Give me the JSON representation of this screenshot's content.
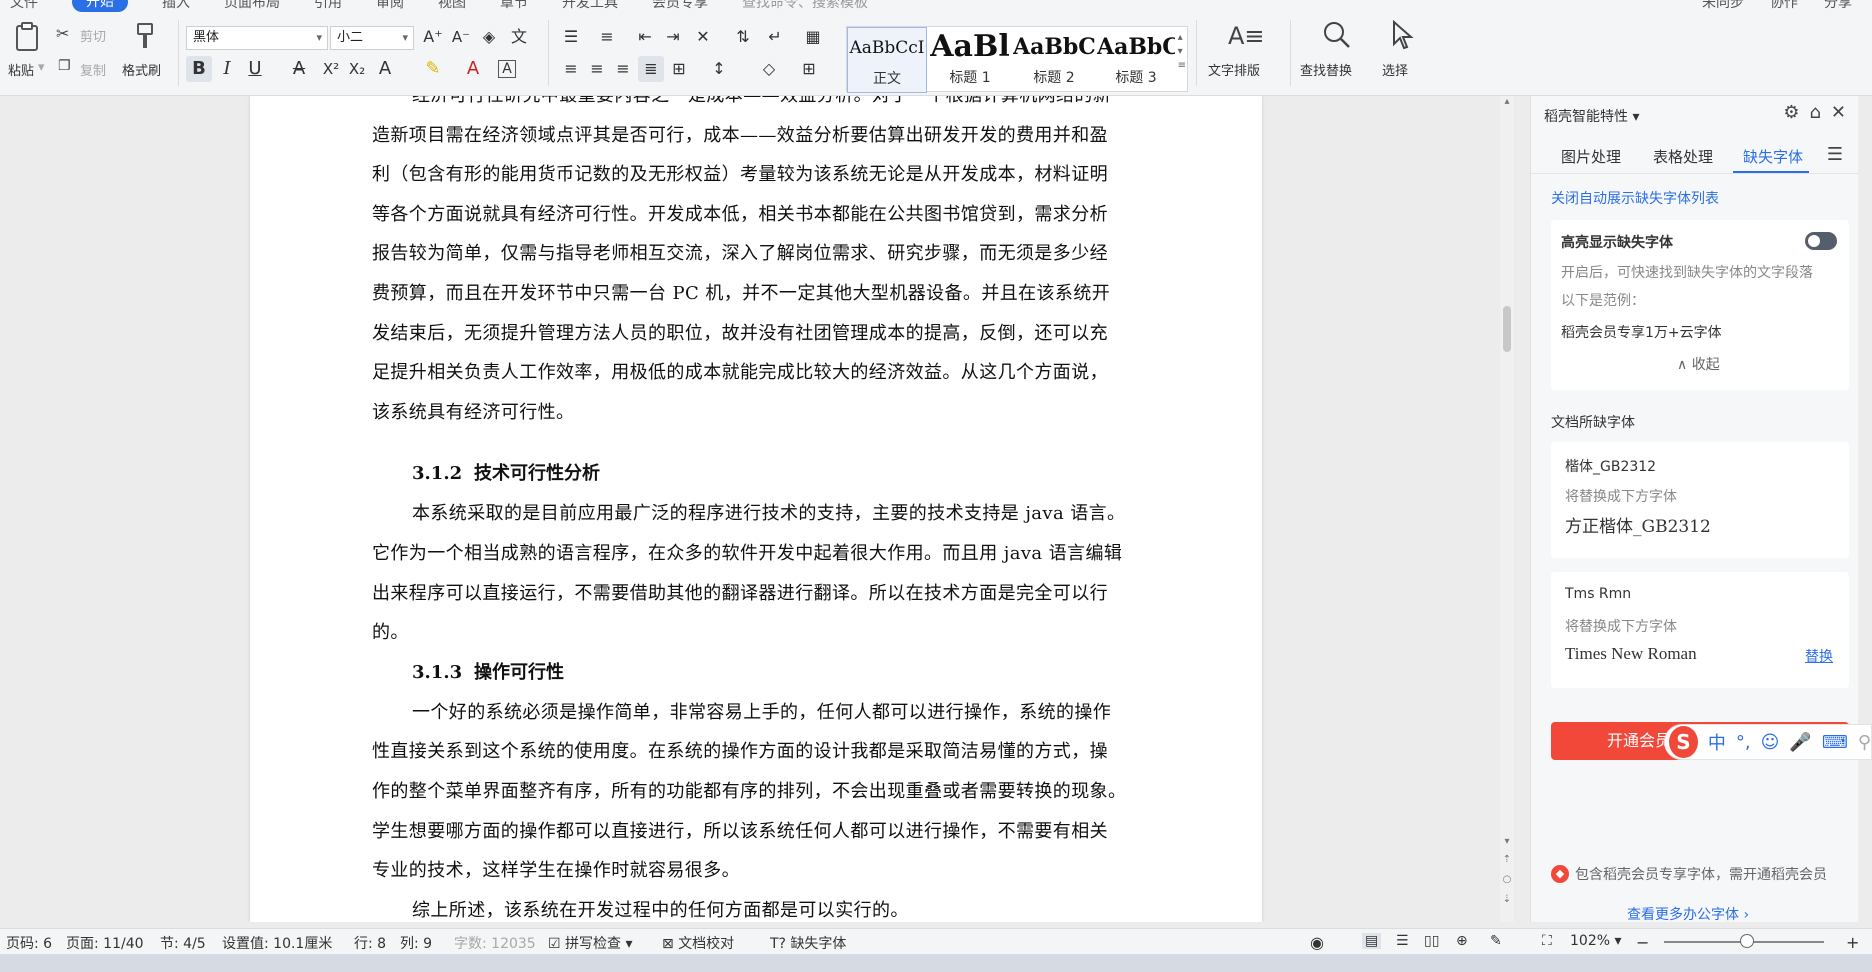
{
  "topbar": {
    "menus": [
      "文件",
      "开始",
      "插入",
      "页面布局",
      "引用",
      "审阅",
      "视图",
      "章节",
      "开发工具",
      "会员专享"
    ],
    "active_menu": "开始",
    "search": "查找命令、搜索模板",
    "right": [
      "未同步",
      "协作",
      "分享"
    ]
  },
  "ribbon": {
    "paste": "粘贴",
    "cut": "剪切",
    "copy": "复制",
    "format_painter": "格式刷",
    "font_name": "黑体",
    "font_size": "小二",
    "styles": [
      {
        "sample": "AaBbCcI",
        "label": "正文"
      },
      {
        "sample": "AaBl",
        "label": "标题 1"
      },
      {
        "sample": "AaBbC",
        "label": "标题 2"
      },
      {
        "sample": "AaBbC",
        "label": "标题 3"
      }
    ],
    "text_layout": "文字排版",
    "find_replace": "查找替换",
    "select": "选择"
  },
  "document": {
    "para1": [
      "经济可行性研究中最重要内容之一是成本——效益分析。对于一个根据计算机网络的新",
      "造新项目需在经济领域点评其是否可行，成本——效益分析要估算出研发开发的费用并和盈",
      "利（包含有形的能用货币记数的及无形权益）考量较为该系统无论是从开发成本，材料证明",
      "等各个方面说就具有经济可行性。开发成本低，相关书本都能在公共图书馆贷到，需求分析",
      "报告较为简单，仅需与指导老师相互交流，深入了解岗位需求、研究步骤，而无须是多少经",
      "费预算，而且在开发环节中只需一台 PC 机，并不一定其他大型机器设备。并且在该系统开",
      "发结束后，无须提升管理方法人员的职位，故并没有社团管理成本的提高，反倒，还可以充",
      "足提升相关负责人工作效率，用极低的成本就能完成比较大的经济效益。从这几个方面说，",
      "该系统具有经济可行性。"
    ],
    "h312_num": "3.1.2",
    "h312_title": "技术可行性分析",
    "para2": [
      "本系统采取的是目前应用最广泛的程序进行技术的支持，主要的技术支持是 java 语言。",
      "它作为一个相当成熟的语言程序，在众多的软件开发中起着很大作用。而且用 java 语言编辑",
      "出来程序可以直接运行，不需要借助其他的翻译器进行翻译。所以在技术方面是完全可以行",
      "的。"
    ],
    "h313_num": "3.1.3",
    "h313_title": "操作可行性",
    "para3": [
      "一个好的系统必须是操作简单，非常容易上手的，任何人都可以进行操作，系统的操作",
      "性直接关系到这个系统的使用度。在系统的操作方面的设计我都是采取简洁易懂的方式，操",
      "作的整个菜单界面整齐有序，所有的功能都有序的排列，不会出现重叠或者需要转换的现象。",
      "学生想要哪方面的操作都可以直接进行，所以该系统任何人都可以进行操作，不需要有相关",
      "专业的技术，这样学生在操作时就容易很多。"
    ],
    "para4": "综上所述，该系统在开发过程中的任何方面都是可以实行的。"
  },
  "panel": {
    "title": "稻壳智能特性",
    "tabs": [
      "图片处理",
      "表格处理",
      "缺失字体"
    ],
    "close_auto_link": "关闭自动展示缺失字体列表",
    "highlight_title": "高亮显示缺失字体",
    "highlight_desc": "开启后，可快速找到缺失字体的文字段落",
    "example_label": "以下是范例：",
    "example_value": "稻壳会员专享1万+云字体",
    "collapse": "收起",
    "missing_section": "文档所缺字体",
    "font1_name": "楷体_GB2312",
    "font1_hint": "将替换成下方字体",
    "font1_replacement": "方正楷体_GB2312",
    "font2_name": "Tms Rmn",
    "font2_hint": "将替换成下方字体",
    "font2_replacement": "Times New Roman",
    "replace_link": "替换",
    "cta_label": "开通会员",
    "note": "包含稻壳会员专享字体，需开通稻壳会员",
    "more_link": "查看更多办公字体"
  },
  "ime": {
    "mode": "中"
  },
  "status": {
    "page_code": "页码: 6",
    "page": "页面: 11/40",
    "section": "节: 4/5",
    "setting": "设置值: 10.1厘米",
    "row": "行: 8",
    "col": "列: 9",
    "wordcount": "字数: 12035",
    "spell": "拼写检查",
    "proof": "文档校对",
    "missing_font": "缺失字体",
    "zoom": "102%"
  }
}
